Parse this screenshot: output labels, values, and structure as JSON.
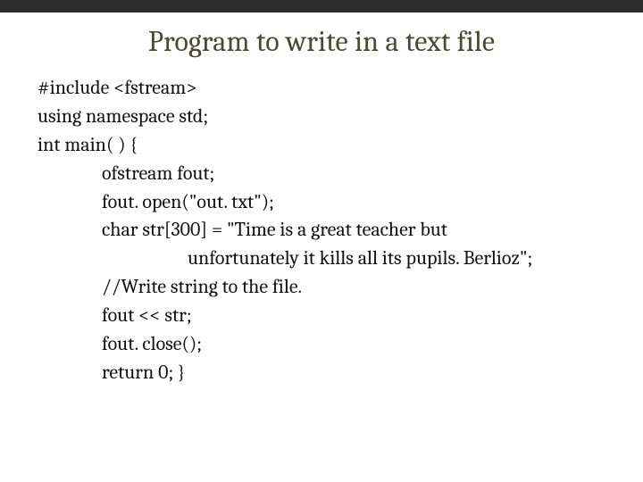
{
  "slide": {
    "title": "Program to write in a text file",
    "code": {
      "l1": "#include <fstream>",
      "l2": "using namespace std;",
      "l3": "int main( ) {",
      "l4": "ofstream fout;",
      "l5": "fout. open(\"out. txt\");",
      "l6": "char str[300] = \"Time is a great teacher but",
      "l7": "unfortunately it kills all its pupils. Berlioz\";",
      "l8": "//Write string to the file.",
      "l9": "fout << str;",
      "l10": "fout. close();",
      "l11": "return 0; }"
    }
  }
}
